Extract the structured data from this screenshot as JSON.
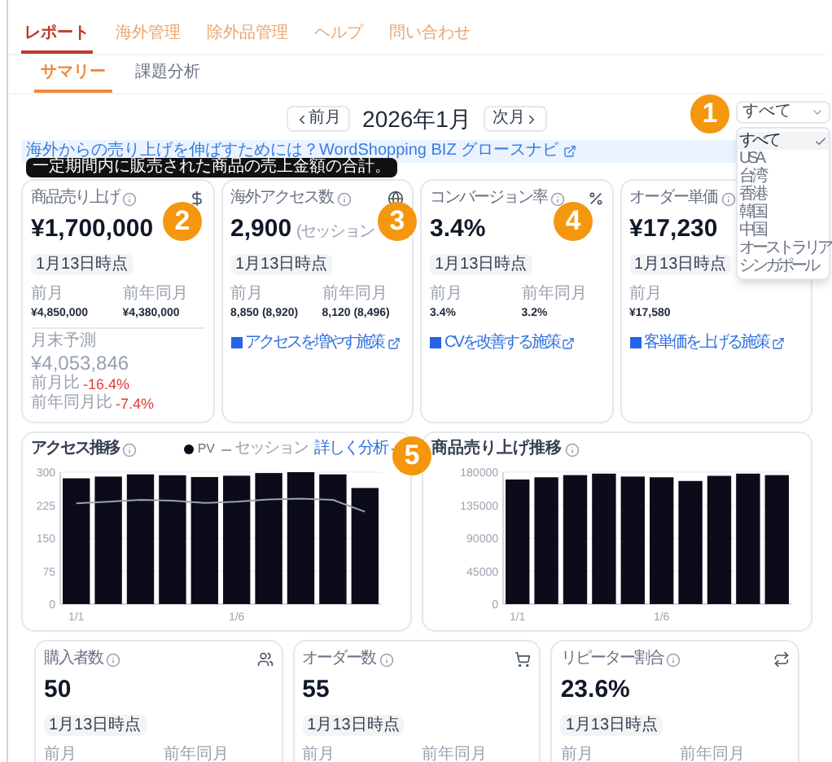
{
  "nav": {
    "tabs": [
      {
        "label": "レポート",
        "selected": true
      },
      {
        "label": "海外管理",
        "selected": false
      },
      {
        "label": "除外品管理",
        "selected": false
      },
      {
        "label": "ヘルプ",
        "selected": false
      },
      {
        "label": "問い合わせ",
        "selected": false
      }
    ]
  },
  "subtabs": [
    {
      "label": "サマリー",
      "selected": true
    },
    {
      "label": "課題分析",
      "selected": false
    }
  ],
  "period": {
    "prev": "前月",
    "current": "2026年1月",
    "next": "次月"
  },
  "region_select": {
    "value": "すべて",
    "options": [
      {
        "label": "すべて",
        "selected": true
      },
      {
        "label": "USA",
        "selected": false
      },
      {
        "label": "台湾",
        "selected": false
      },
      {
        "label": "香港",
        "selected": false
      },
      {
        "label": "韓国",
        "selected": false
      },
      {
        "label": "中国",
        "selected": false
      },
      {
        "label": "オーストラリア",
        "selected": false
      },
      {
        "label": "シンガポール",
        "selected": false
      }
    ]
  },
  "banner": "海外からの売り上げを伸ばすためには？WordShopping BIZ グロースナビ",
  "tooltip": "一定期間内に販売された商品の売上金額の合計。",
  "cards": [
    {
      "title": "商品売り上げ",
      "value": "¥1,700,000",
      "badge": "1月13日時点",
      "compare": [
        {
          "label": "前月",
          "value": "¥4,850,000"
        },
        {
          "label": "前年同月",
          "value": "¥4,380,000"
        }
      ],
      "forecast": {
        "label": "月末予測",
        "value": "¥4,053,846",
        "ratios": [
          {
            "label": "前月比",
            "value": "-16.4%"
          },
          {
            "label": "前年同月比",
            "value": "-7.4%"
          }
        ]
      }
    },
    {
      "title": "海外アクセス数",
      "value": "2,900",
      "sub": "(セッション",
      "badge": "1月13日時点",
      "compare": [
        {
          "label": "前月",
          "value": "8,850 (8,920)"
        },
        {
          "label": "前年同月",
          "value": "8,120 (8,496)"
        }
      ],
      "link": "アクセスを増やす施策"
    },
    {
      "title": "コンバージョン率",
      "value": "3.4%",
      "badge": "1月13日時点",
      "compare": [
        {
          "label": "前月",
          "value": "3.4%"
        },
        {
          "label": "前年同月",
          "value": "3.2%"
        }
      ],
      "link": "CVを改善する施策"
    },
    {
      "title": "オーダー単価",
      "value": "¥17,230",
      "badge": "1月13日時点",
      "compare": [
        {
          "label": "前月",
          "value": "¥17,580"
        }
      ],
      "link": "客単価を上げる施策"
    }
  ],
  "access_chart": {
    "title": "アクセス推移",
    "more": "詳しく分析",
    "chart_data": {
      "type": "bar",
      "grid": true,
      "categories": [
        "1/1",
        null,
        null,
        null,
        null,
        "1/6",
        null,
        null,
        null,
        null
      ],
      "ylim": [
        0,
        300
      ],
      "yticks": [
        0,
        75,
        150,
        225,
        300
      ],
      "series": [
        {
          "name": "PV",
          "type": "bar",
          "color": "#0b0b1a",
          "values": [
            286,
            290,
            295,
            293,
            289,
            292,
            298,
            300,
            295,
            264
          ]
        },
        {
          "name": "セッション",
          "type": "line",
          "color": "#9ca3af",
          "values": [
            229,
            233,
            237,
            235,
            230,
            233,
            238,
            240,
            237,
            210
          ]
        }
      ]
    }
  },
  "sales_chart": {
    "title": "商品売り上げ推移",
    "chart_data": {
      "type": "bar",
      "grid": true,
      "categories": [
        "1/1",
        null,
        null,
        null,
        null,
        "1/6",
        null,
        null,
        null,
        null
      ],
      "ylim": [
        0,
        180000
      ],
      "yticks": [
        0,
        45000,
        90000,
        135000,
        180000
      ],
      "series": [
        {
          "type": "bar",
          "color": "#0b0b1a",
          "values": [
            170000,
            173000,
            176000,
            178000,
            174000,
            173000,
            168000,
            175000,
            178000,
            176000
          ]
        }
      ]
    }
  },
  "bottom_cards": [
    {
      "title": "購入者数",
      "value": "50",
      "badge": "1月13日時点",
      "compare": [
        {
          "label": "前月"
        },
        {
          "label": "前年同月"
        }
      ]
    },
    {
      "title": "オーダー数",
      "value": "55",
      "badge": "1月13日時点",
      "compare": [
        {
          "label": "前月"
        },
        {
          "label": "前年同月"
        }
      ]
    },
    {
      "title": "リピーター割合",
      "value": "23.6%",
      "badge": "1月13日時点",
      "compare": [
        {
          "label": "前月"
        },
        {
          "label": "前年同月"
        }
      ]
    }
  ],
  "callouts": [
    "1",
    "2",
    "3",
    "4",
    "5"
  ]
}
